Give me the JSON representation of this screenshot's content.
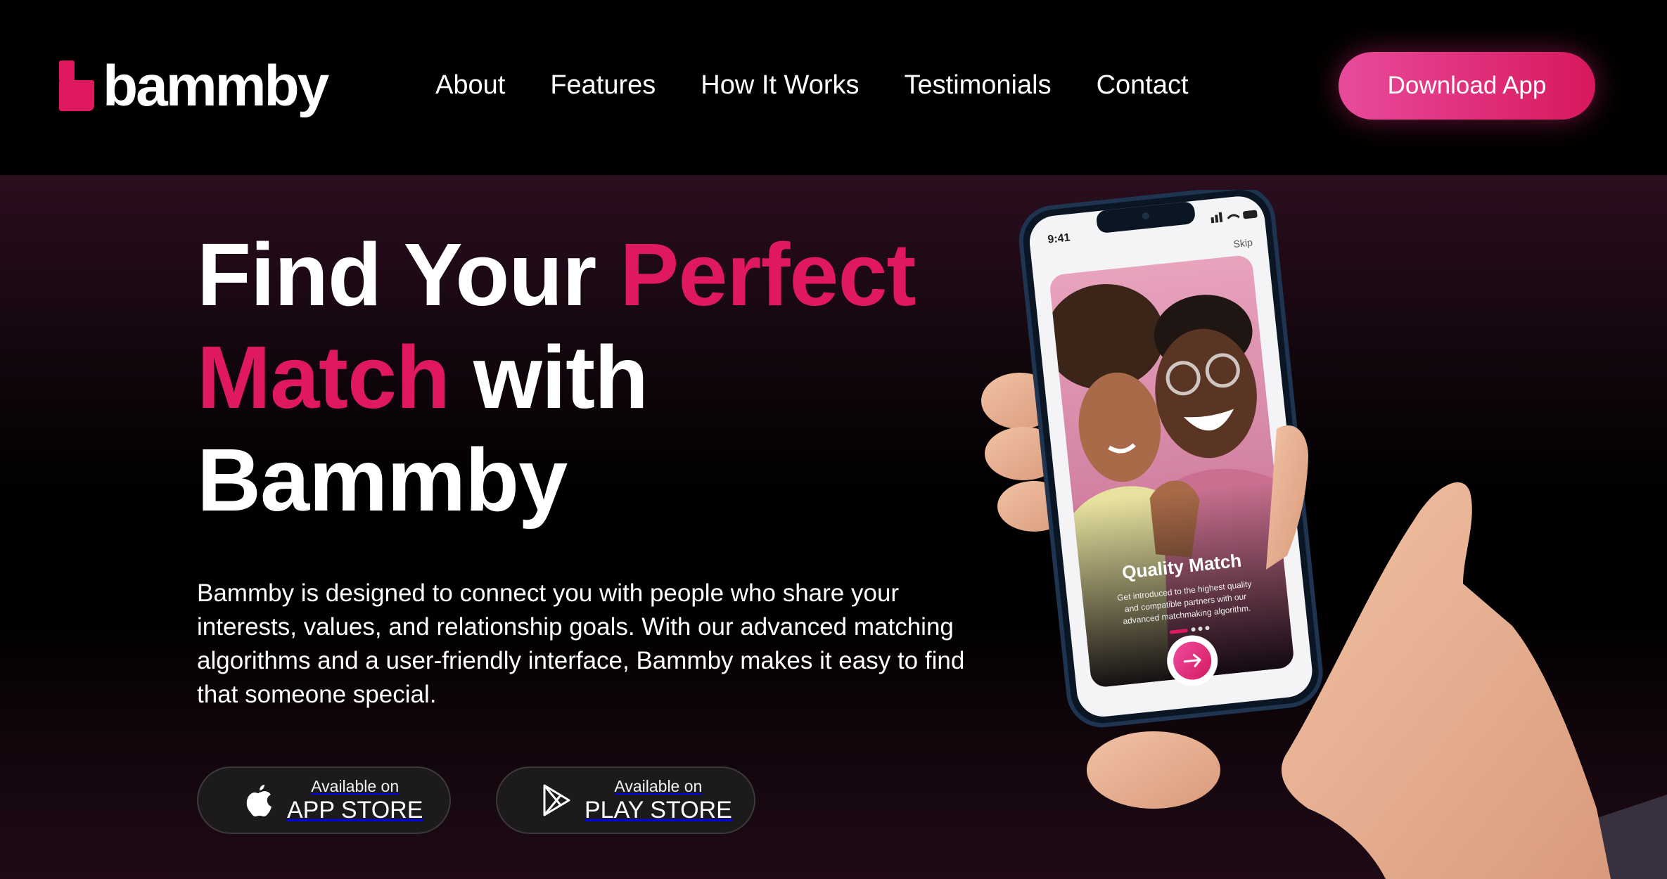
{
  "brand": {
    "name": "bammby",
    "accent_color": "#e0185f"
  },
  "nav": {
    "items": [
      {
        "label": "About"
      },
      {
        "label": "Features"
      },
      {
        "label": "How It Works"
      },
      {
        "label": "Testimonials"
      },
      {
        "label": "Contact"
      }
    ]
  },
  "header": {
    "cta_label": "Download App"
  },
  "hero": {
    "headline": {
      "line1_white": "Find Your ",
      "line1_accent": "Perfect",
      "line2_accent": "Match",
      "line2_white": " with",
      "line3_white": "Bammby"
    },
    "description": "Bammby is designed to connect you with people who share your interests, values, and relationship goals. With our advanced matching algorithms and a user-friendly interface, Bammby makes it easy to find that someone special.",
    "stores": [
      {
        "small": "Available on",
        "big": "APP STORE",
        "icon": "apple-icon"
      },
      {
        "small": "Available on",
        "big": "PLAY STORE",
        "icon": "play-store-icon"
      }
    ]
  },
  "phone_screen": {
    "time": "9:41",
    "skip_label": "Skip",
    "card_title": "Quality Match",
    "card_description_line1": "Get introduced to the highest quality",
    "card_description_line2": "and compatible partners with our",
    "card_description_line3": "advanced matchmaking algorithm.",
    "next_icon": "arrow-right-icon"
  }
}
